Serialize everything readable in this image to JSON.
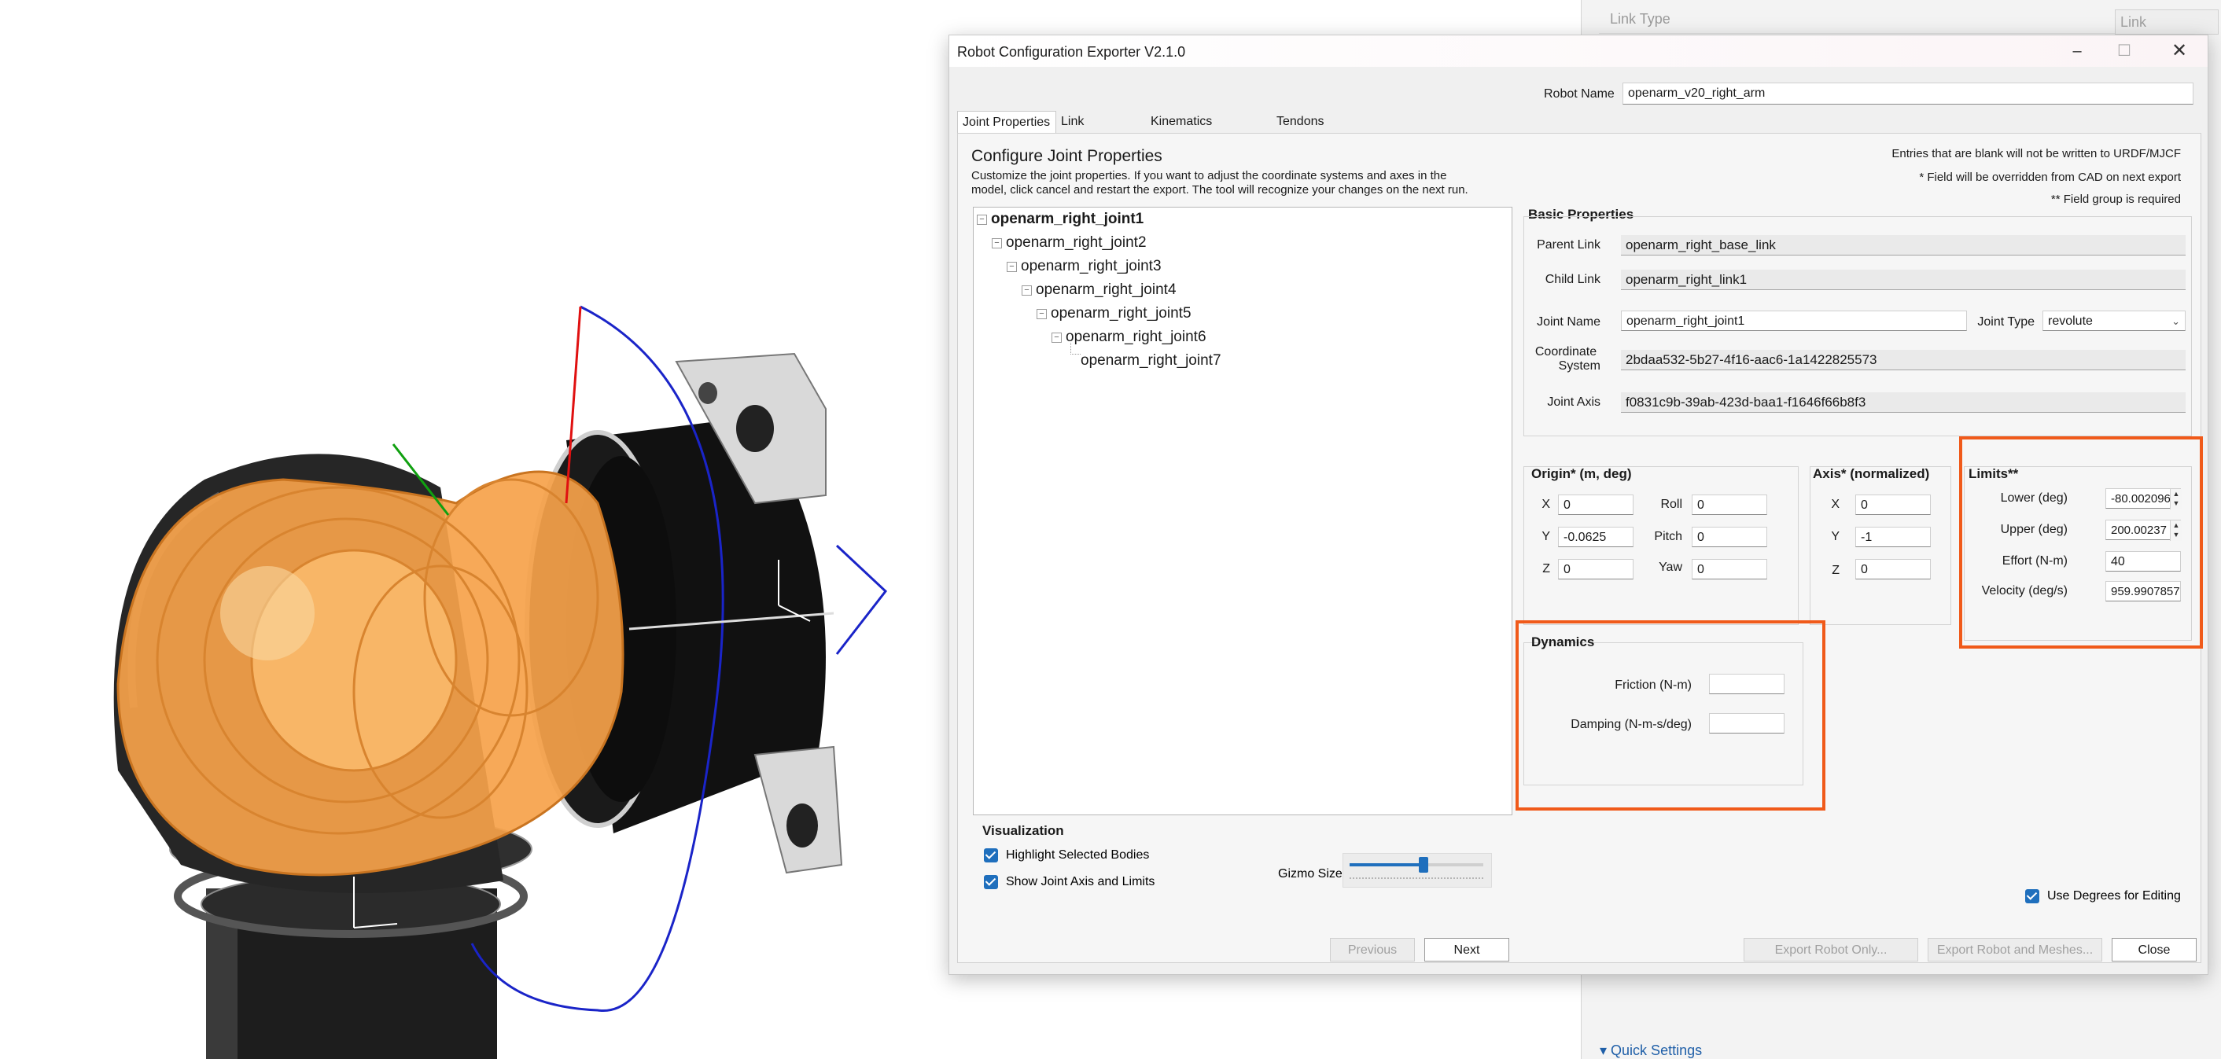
{
  "background_panel": {
    "link_type_label": "Link Type",
    "link_type_value": "Link",
    "quick_settings": "Quick Settings"
  },
  "dialog": {
    "title": "Robot Configuration Exporter V2.1.0",
    "robot_name_label": "Robot Name",
    "robot_name_value": "openarm_v20_right_arm",
    "tabs": [
      {
        "label": "Joint Properties",
        "active": true
      },
      {
        "label": "Link Properties",
        "active": false
      },
      {
        "label": "Kinematics Summary",
        "active": false
      },
      {
        "label": "Tendons Summary",
        "active": false
      }
    ],
    "heading": "Configure Joint Properties",
    "description_line1": "Customize the joint properties. If you want to adjust the coordinate systems and axes in the",
    "description_line2": "model, click cancel and restart the export. The tool will recognize your changes on the next run.",
    "notes": [
      "Entries that are blank will not be written to URDF/MJCF",
      "* Field will be overridden from CAD on next export",
      "** Field group is required"
    ],
    "tree": [
      {
        "label": "openarm_right_joint1",
        "bold": true
      },
      {
        "label": "openarm_right_joint2",
        "bold": false
      },
      {
        "label": "openarm_right_joint3",
        "bold": false
      },
      {
        "label": "openarm_right_joint4",
        "bold": false
      },
      {
        "label": "openarm_right_joint5",
        "bold": false
      },
      {
        "label": "openarm_right_joint6",
        "bold": false
      },
      {
        "label": "openarm_right_joint7",
        "bold": false
      }
    ],
    "basic": {
      "title": "Basic Properties",
      "parent_link_label": "Parent Link",
      "parent_link_value": "openarm_right_base_link",
      "child_link_label": "Child Link",
      "child_link_value": "openarm_right_link1",
      "joint_name_label": "Joint Name",
      "joint_name_value": "openarm_right_joint1",
      "joint_type_label": "Joint Type",
      "joint_type_value": "revolute",
      "coord_label_1": "Coordinate",
      "coord_label_2": "System",
      "coord_value": "2bdaa532-5b27-4f16-aac6-1a1422825573",
      "joint_axis_label": "Joint Axis",
      "joint_axis_value": "f0831c9b-39ab-423d-baa1-f1646f66b8f3"
    },
    "origin": {
      "title": "Origin* (m, deg)",
      "x_label": "X",
      "x_value": "0",
      "y_label": "Y",
      "y_value": "-0.0625",
      "z_label": "Z",
      "z_value": "0",
      "roll_label": "Roll",
      "roll_value": "0",
      "pitch_label": "Pitch",
      "pitch_value": "0",
      "yaw_label": "Yaw",
      "yaw_value": "0"
    },
    "axis": {
      "title": "Axis* (normalized)",
      "x_label": "X",
      "x_value": "0",
      "y_label": "Y",
      "y_value": "-1",
      "z_label": "Z",
      "z_value": "0"
    },
    "limits": {
      "title": "Limits**",
      "lower_label": "Lower (deg)",
      "lower_value": "-80.002096",
      "upper_label": "Upper (deg)",
      "upper_value": "200.00237",
      "effort_label": "Effort (N-m)",
      "effort_value": "40",
      "velocity_label": "Velocity (deg/s)",
      "velocity_value": "959.9907857"
    },
    "dynamics": {
      "title": "Dynamics",
      "friction_label": "Friction (N-m)",
      "friction_value": "",
      "damping_label": "Damping (N-m-s/deg)",
      "damping_value": ""
    },
    "visualization": {
      "title": "Visualization",
      "highlight_label": "Highlight Selected Bodies",
      "highlight_checked": true,
      "show_axis_label": "Show Joint Axis and Limits",
      "show_axis_checked": true,
      "gizmo_label": "Gizmo Size",
      "gizmo_level": 0.55
    },
    "use_degrees_label": "Use Degrees for Editing",
    "use_degrees_checked": true,
    "buttons": {
      "previous": "Previous",
      "next": "Next",
      "export_robot_only": "Export Robot Only...",
      "export_robot_meshes": "Export Robot and Meshes...",
      "close": "Close"
    },
    "colors": {
      "highlight_orange": "#f05a1a",
      "check_blue": "#1f6fbd",
      "part_orange": "#f6a24a"
    }
  }
}
